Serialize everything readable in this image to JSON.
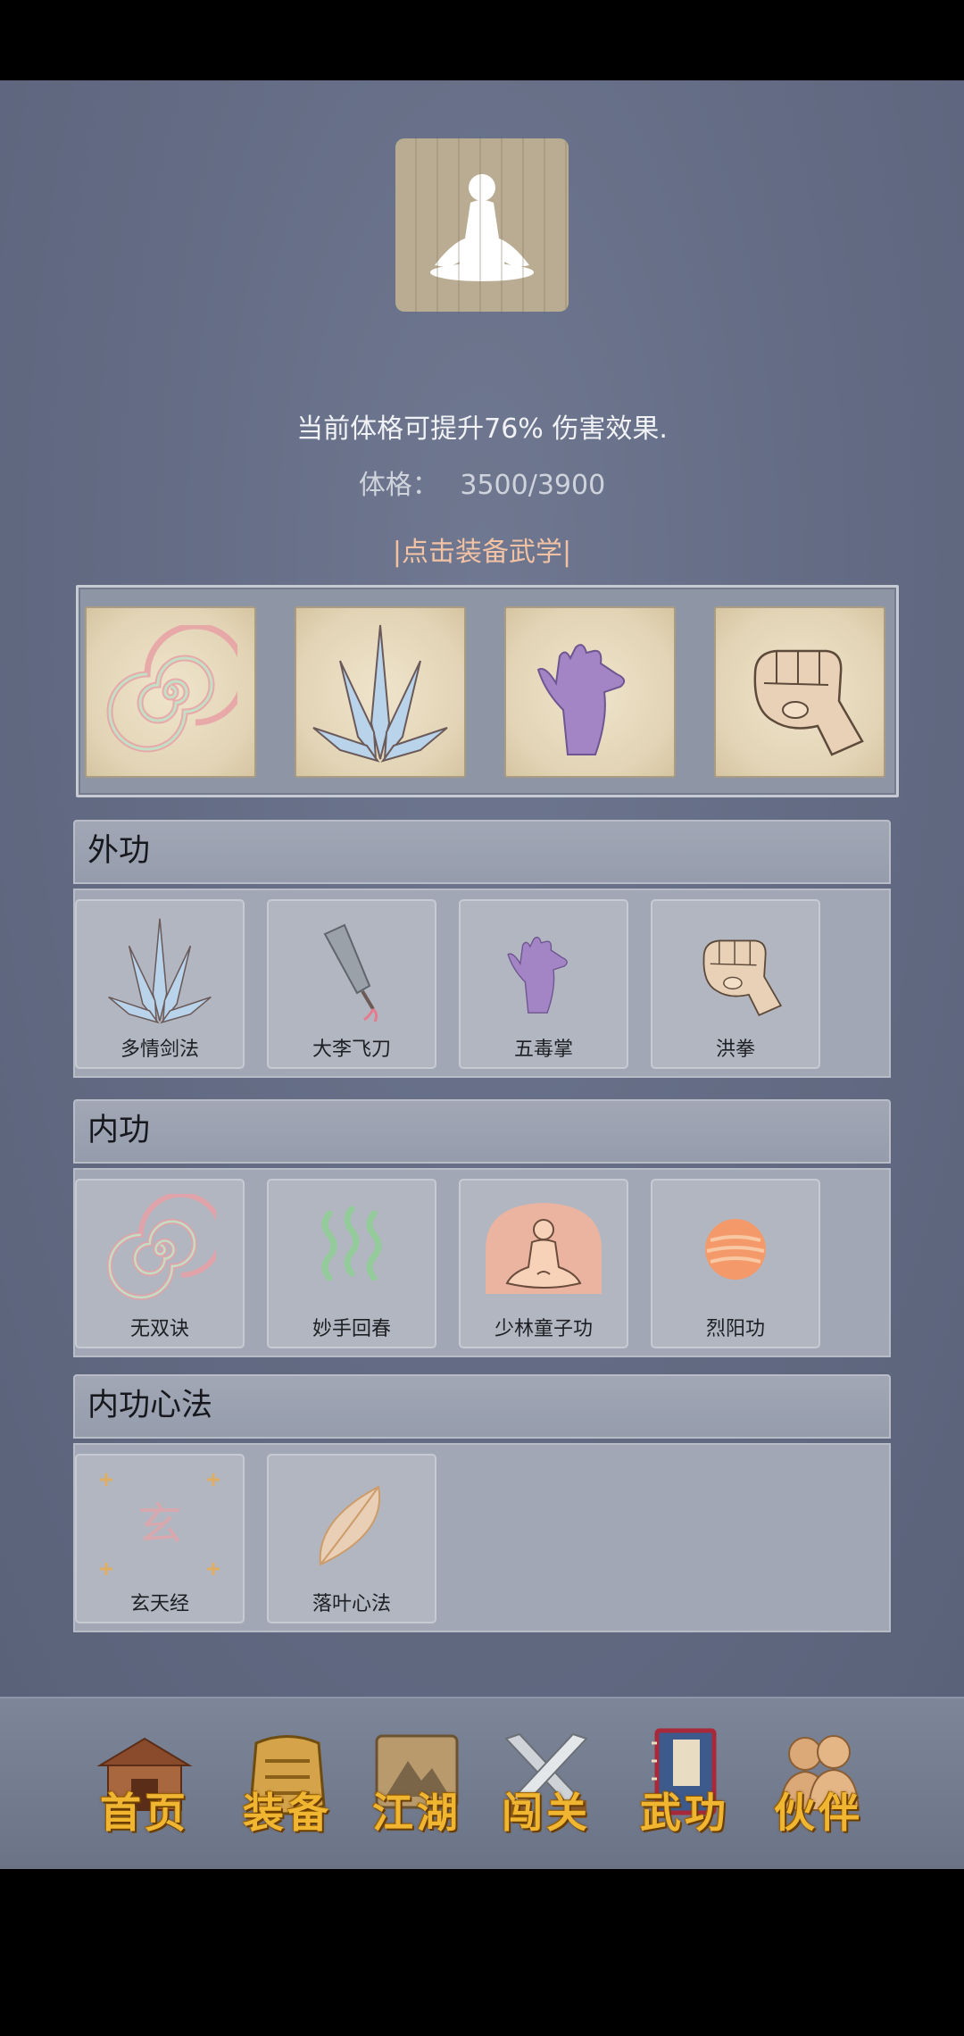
{
  "header": {
    "description": "当前体格可提升76% 伤害效果.",
    "stat_label": "体格：",
    "stat_value": "3500/3900",
    "equip_prompt": "|点击装备武学|"
  },
  "equipped": [
    {
      "icon": "spiral-icon"
    },
    {
      "icon": "blades-icon"
    },
    {
      "icon": "purple-palm-icon"
    },
    {
      "icon": "fist-icon"
    }
  ],
  "sections": [
    {
      "title": "外功",
      "items": [
        {
          "label": "多情剑法",
          "icon": "blades-icon"
        },
        {
          "label": "大李飞刀",
          "icon": "flying-knife-icon"
        },
        {
          "label": "五毒掌",
          "icon": "purple-palm-icon"
        },
        {
          "label": "洪拳",
          "icon": "fist-icon"
        }
      ]
    },
    {
      "title": "内功",
      "items": [
        {
          "label": "无双诀",
          "icon": "spiral-icon"
        },
        {
          "label": "妙手回春",
          "icon": "green-waves-icon"
        },
        {
          "label": "少林童子功",
          "icon": "meditating-monk-icon"
        },
        {
          "label": "烈阳功",
          "icon": "sun-icon"
        }
      ]
    },
    {
      "title": "内功心法",
      "items": [
        {
          "label": "玄天经",
          "icon": "xuan-character-icon",
          "glyph": "玄"
        },
        {
          "label": "落叶心法",
          "icon": "leaf-icon"
        }
      ]
    }
  ],
  "nav": [
    {
      "label": "首页",
      "icon": "temple-icon"
    },
    {
      "label": "装备",
      "icon": "armor-icon"
    },
    {
      "label": "江湖",
      "icon": "scroll-map-icon"
    },
    {
      "label": "闯关",
      "icon": "crossed-swords-icon"
    },
    {
      "label": "武功",
      "icon": "martial-book-icon"
    },
    {
      "label": "伙伴",
      "icon": "companions-icon"
    }
  ],
  "colors": {
    "background": "#646d85",
    "equip_prompt": "#f3c2a4",
    "nav_text": "#f0b632"
  }
}
